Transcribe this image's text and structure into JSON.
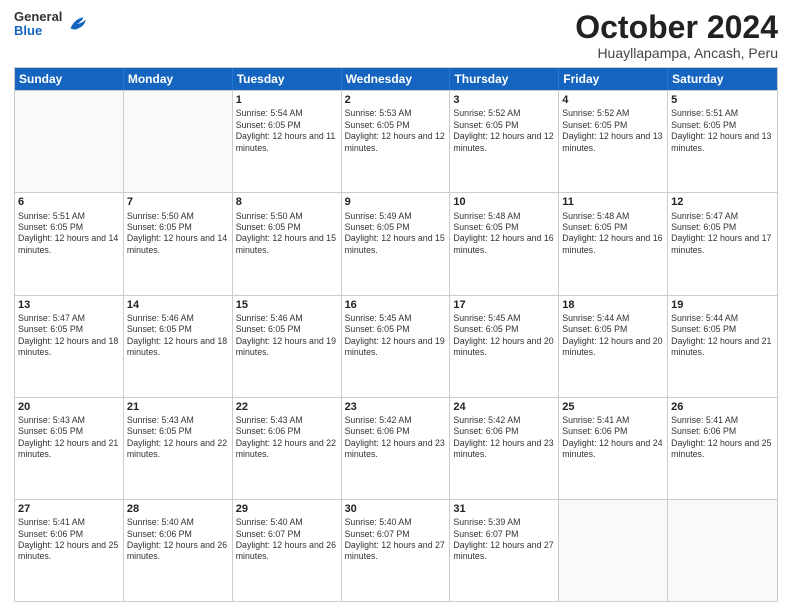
{
  "header": {
    "logo": {
      "general": "General",
      "blue": "Blue"
    },
    "title": "October 2024",
    "subtitle": "Huayllapampa, Ancash, Peru"
  },
  "weekdays": [
    "Sunday",
    "Monday",
    "Tuesday",
    "Wednesday",
    "Thursday",
    "Friday",
    "Saturday"
  ],
  "weeks": [
    [
      {
        "day": "",
        "sunrise": "",
        "sunset": "",
        "daylight": "",
        "empty": true
      },
      {
        "day": "",
        "sunrise": "",
        "sunset": "",
        "daylight": "",
        "empty": true
      },
      {
        "day": "1",
        "sunrise": "Sunrise: 5:54 AM",
        "sunset": "Sunset: 6:05 PM",
        "daylight": "Daylight: 12 hours and 11 minutes.",
        "empty": false
      },
      {
        "day": "2",
        "sunrise": "Sunrise: 5:53 AM",
        "sunset": "Sunset: 6:05 PM",
        "daylight": "Daylight: 12 hours and 12 minutes.",
        "empty": false
      },
      {
        "day": "3",
        "sunrise": "Sunrise: 5:52 AM",
        "sunset": "Sunset: 6:05 PM",
        "daylight": "Daylight: 12 hours and 12 minutes.",
        "empty": false
      },
      {
        "day": "4",
        "sunrise": "Sunrise: 5:52 AM",
        "sunset": "Sunset: 6:05 PM",
        "daylight": "Daylight: 12 hours and 13 minutes.",
        "empty": false
      },
      {
        "day": "5",
        "sunrise": "Sunrise: 5:51 AM",
        "sunset": "Sunset: 6:05 PM",
        "daylight": "Daylight: 12 hours and 13 minutes.",
        "empty": false
      }
    ],
    [
      {
        "day": "6",
        "sunrise": "Sunrise: 5:51 AM",
        "sunset": "Sunset: 6:05 PM",
        "daylight": "Daylight: 12 hours and 14 minutes.",
        "empty": false
      },
      {
        "day": "7",
        "sunrise": "Sunrise: 5:50 AM",
        "sunset": "Sunset: 6:05 PM",
        "daylight": "Daylight: 12 hours and 14 minutes.",
        "empty": false
      },
      {
        "day": "8",
        "sunrise": "Sunrise: 5:50 AM",
        "sunset": "Sunset: 6:05 PM",
        "daylight": "Daylight: 12 hours and 15 minutes.",
        "empty": false
      },
      {
        "day": "9",
        "sunrise": "Sunrise: 5:49 AM",
        "sunset": "Sunset: 6:05 PM",
        "daylight": "Daylight: 12 hours and 15 minutes.",
        "empty": false
      },
      {
        "day": "10",
        "sunrise": "Sunrise: 5:48 AM",
        "sunset": "Sunset: 6:05 PM",
        "daylight": "Daylight: 12 hours and 16 minutes.",
        "empty": false
      },
      {
        "day": "11",
        "sunrise": "Sunrise: 5:48 AM",
        "sunset": "Sunset: 6:05 PM",
        "daylight": "Daylight: 12 hours and 16 minutes.",
        "empty": false
      },
      {
        "day": "12",
        "sunrise": "Sunrise: 5:47 AM",
        "sunset": "Sunset: 6:05 PM",
        "daylight": "Daylight: 12 hours and 17 minutes.",
        "empty": false
      }
    ],
    [
      {
        "day": "13",
        "sunrise": "Sunrise: 5:47 AM",
        "sunset": "Sunset: 6:05 PM",
        "daylight": "Daylight: 12 hours and 18 minutes.",
        "empty": false
      },
      {
        "day": "14",
        "sunrise": "Sunrise: 5:46 AM",
        "sunset": "Sunset: 6:05 PM",
        "daylight": "Daylight: 12 hours and 18 minutes.",
        "empty": false
      },
      {
        "day": "15",
        "sunrise": "Sunrise: 5:46 AM",
        "sunset": "Sunset: 6:05 PM",
        "daylight": "Daylight: 12 hours and 19 minutes.",
        "empty": false
      },
      {
        "day": "16",
        "sunrise": "Sunrise: 5:45 AM",
        "sunset": "Sunset: 6:05 PM",
        "daylight": "Daylight: 12 hours and 19 minutes.",
        "empty": false
      },
      {
        "day": "17",
        "sunrise": "Sunrise: 5:45 AM",
        "sunset": "Sunset: 6:05 PM",
        "daylight": "Daylight: 12 hours and 20 minutes.",
        "empty": false
      },
      {
        "day": "18",
        "sunrise": "Sunrise: 5:44 AM",
        "sunset": "Sunset: 6:05 PM",
        "daylight": "Daylight: 12 hours and 20 minutes.",
        "empty": false
      },
      {
        "day": "19",
        "sunrise": "Sunrise: 5:44 AM",
        "sunset": "Sunset: 6:05 PM",
        "daylight": "Daylight: 12 hours and 21 minutes.",
        "empty": false
      }
    ],
    [
      {
        "day": "20",
        "sunrise": "Sunrise: 5:43 AM",
        "sunset": "Sunset: 6:05 PM",
        "daylight": "Daylight: 12 hours and 21 minutes.",
        "empty": false
      },
      {
        "day": "21",
        "sunrise": "Sunrise: 5:43 AM",
        "sunset": "Sunset: 6:05 PM",
        "daylight": "Daylight: 12 hours and 22 minutes.",
        "empty": false
      },
      {
        "day": "22",
        "sunrise": "Sunrise: 5:43 AM",
        "sunset": "Sunset: 6:06 PM",
        "daylight": "Daylight: 12 hours and 22 minutes.",
        "empty": false
      },
      {
        "day": "23",
        "sunrise": "Sunrise: 5:42 AM",
        "sunset": "Sunset: 6:06 PM",
        "daylight": "Daylight: 12 hours and 23 minutes.",
        "empty": false
      },
      {
        "day": "24",
        "sunrise": "Sunrise: 5:42 AM",
        "sunset": "Sunset: 6:06 PM",
        "daylight": "Daylight: 12 hours and 23 minutes.",
        "empty": false
      },
      {
        "day": "25",
        "sunrise": "Sunrise: 5:41 AM",
        "sunset": "Sunset: 6:06 PM",
        "daylight": "Daylight: 12 hours and 24 minutes.",
        "empty": false
      },
      {
        "day": "26",
        "sunrise": "Sunrise: 5:41 AM",
        "sunset": "Sunset: 6:06 PM",
        "daylight": "Daylight: 12 hours and 25 minutes.",
        "empty": false
      }
    ],
    [
      {
        "day": "27",
        "sunrise": "Sunrise: 5:41 AM",
        "sunset": "Sunset: 6:06 PM",
        "daylight": "Daylight: 12 hours and 25 minutes.",
        "empty": false
      },
      {
        "day": "28",
        "sunrise": "Sunrise: 5:40 AM",
        "sunset": "Sunset: 6:06 PM",
        "daylight": "Daylight: 12 hours and 26 minutes.",
        "empty": false
      },
      {
        "day": "29",
        "sunrise": "Sunrise: 5:40 AM",
        "sunset": "Sunset: 6:07 PM",
        "daylight": "Daylight: 12 hours and 26 minutes.",
        "empty": false
      },
      {
        "day": "30",
        "sunrise": "Sunrise: 5:40 AM",
        "sunset": "Sunset: 6:07 PM",
        "daylight": "Daylight: 12 hours and 27 minutes.",
        "empty": false
      },
      {
        "day": "31",
        "sunrise": "Sunrise: 5:39 AM",
        "sunset": "Sunset: 6:07 PM",
        "daylight": "Daylight: 12 hours and 27 minutes.",
        "empty": false
      },
      {
        "day": "",
        "sunrise": "",
        "sunset": "",
        "daylight": "",
        "empty": true
      },
      {
        "day": "",
        "sunrise": "",
        "sunset": "",
        "daylight": "",
        "empty": true
      }
    ]
  ]
}
